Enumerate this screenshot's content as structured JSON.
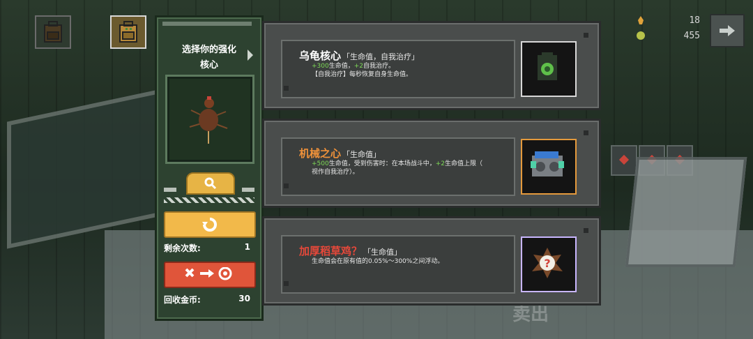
{
  "panel": {
    "title_line1": "选择你的强化",
    "title_line2": "核心",
    "remaining_label": "剩余次数:",
    "remaining_value": "1",
    "recycle_label": "回收金币:",
    "recycle_value": "30"
  },
  "hud": {
    "value_top": "18",
    "value_bottom": "455",
    "next_icon": "arrow-right-icon"
  },
  "options": [
    {
      "name": "乌龟核心",
      "name_color": "#ffffff",
      "tag": "「生命值，自我治疗」",
      "desc_line1_g1": "+300",
      "desc_line1_t1": "生命值，",
      "desc_line1_g2": "+2",
      "desc_line1_t2": "自我治疗。",
      "desc_line2": "【自我治疗】每秒恢复自身生命值。",
      "icon": "turtle-core-icon"
    },
    {
      "name": "机械之心",
      "name_color": "#f0923a",
      "tag": "「生命值」",
      "desc_line1_g1": "+500",
      "desc_line1_t1": "生命值，受到伤害时：在本场战斗中，",
      "desc_line1_g2": "+2",
      "desc_line1_t2": "生命值上限（",
      "desc_line2": "视作自我治疗）。",
      "icon": "mechanical-heart-icon"
    },
    {
      "name": "加厚稻草鸡？",
      "name_color": "#e5483a",
      "tag": "「生命值」",
      "desc_line1_t1": "生命值会在原有值的0.05%～300%之间浮动。",
      "icon": "mystery-chicken-icon"
    }
  ],
  "background": {
    "sell_label": "卖出"
  }
}
